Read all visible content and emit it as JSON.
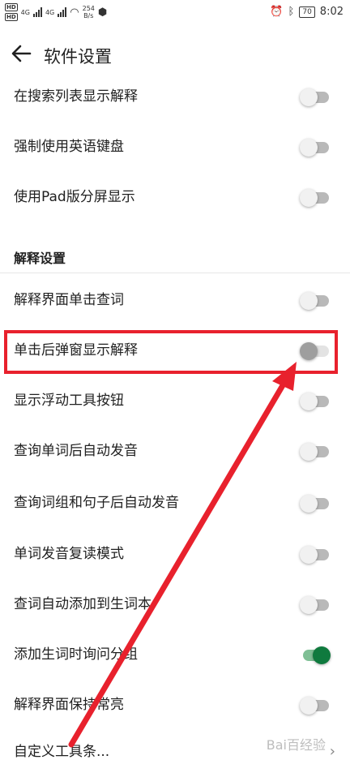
{
  "status_bar": {
    "hd1": "HD",
    "hd2": "HD",
    "net1": "4G",
    "net2": "4G",
    "speed": "254",
    "speed_unit": "B/s",
    "battery": "70",
    "time": "8:02"
  },
  "header": {
    "title": "软件设置"
  },
  "top_settings": [
    {
      "label": "在搜索列表显示解释",
      "on": false
    },
    {
      "label": "强制使用英语键盘",
      "on": false
    },
    {
      "label": "使用Pad版分屏显示",
      "on": false
    }
  ],
  "section_title": "解释设置",
  "settings": [
    {
      "label": "解释界面单击查词",
      "on": false
    },
    {
      "label": "单击后弹窗显示解释",
      "on": false
    },
    {
      "label": "显示浮动工具按钮",
      "on": false
    },
    {
      "label": "查询单词后自动发音",
      "on": false
    },
    {
      "label": "查询词组和句子后自动发音",
      "on": false
    },
    {
      "label": "单词发音复读模式",
      "on": false
    },
    {
      "label": "查词自动添加到生词本",
      "on": false
    },
    {
      "label": "添加生词时询问分组",
      "on": true
    },
    {
      "label": "解释界面保持常亮",
      "on": false
    }
  ],
  "custom_toolbar": {
    "label": "自定义工具条..."
  },
  "watermark": "Bai百经验",
  "colors": {
    "accent_on": "#0f7a3e",
    "annotation_red": "#e8212d"
  }
}
